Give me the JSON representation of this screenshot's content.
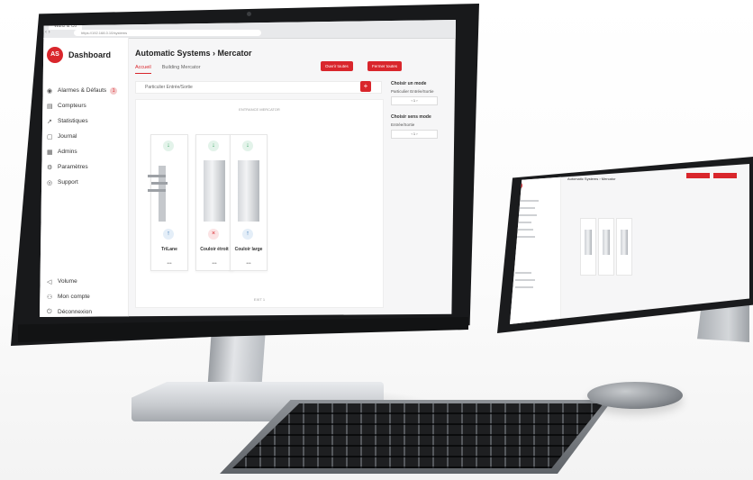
{
  "browser": {
    "tab_title": "Wanz & Co",
    "url": "https://192.168.0.10/systems"
  },
  "app": {
    "logo_text": "AS",
    "title": "Dashboard",
    "sidebar": [
      {
        "label": "Alarmes & Défauts",
        "icon": "bell-icon",
        "badge": "1"
      },
      {
        "label": "Compteurs",
        "icon": "counter-icon"
      },
      {
        "label": "Statistiques",
        "icon": "chart-icon"
      },
      {
        "label": "Journal",
        "icon": "journal-icon"
      },
      {
        "label": "Admins",
        "icon": "admins-icon"
      },
      {
        "label": "Paramètres",
        "icon": "gear-icon"
      },
      {
        "label": "Support",
        "icon": "support-icon"
      }
    ],
    "sidebar_bottom": [
      {
        "label": "Volume",
        "icon": "speaker-icon"
      },
      {
        "label": "Mon compte",
        "icon": "user-icon"
      },
      {
        "label": "Déconnexion",
        "icon": "power-icon"
      }
    ],
    "breadcrumb": "Automatic Systems › Mercator",
    "tabs": [
      {
        "label": "Accueil",
        "active": true
      },
      {
        "label": "Building Mercator",
        "active": false
      }
    ],
    "actions": {
      "primary": "Ouvrir toutes",
      "secondary": "Fermer toutes"
    },
    "filter": "Particulier Entrée/Sortie",
    "panel_header": "ENTRANCE MERCATOR",
    "panel_footer": "EXIT 1",
    "devices": [
      {
        "name": "TriLane",
        "status": "ok"
      },
      {
        "name": "Couloir étroit",
        "status": "alarm"
      },
      {
        "name": "Couloir large",
        "status": "ok"
      }
    ],
    "right_panel": {
      "section1_title": "Choisir un mode",
      "section1_label": "Particulier Entrée/Sortie",
      "section2_title": "Choisir sens mode",
      "section2_label": "Entrée/Sortie"
    }
  },
  "tablet": {
    "title": "Automatic Systems › Mercator"
  },
  "colors": {
    "accent": "#d9262c",
    "ok": "#2f9e5a",
    "info": "#2f6fb0"
  }
}
